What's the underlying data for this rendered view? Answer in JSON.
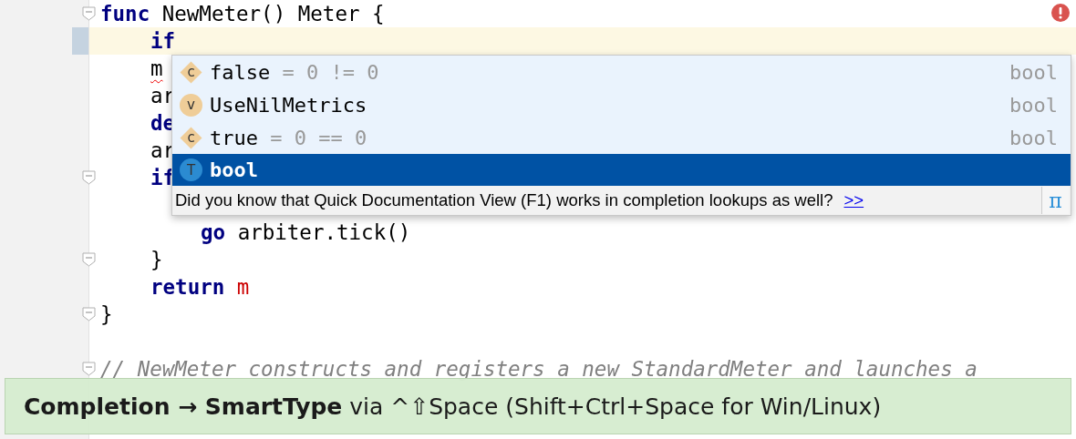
{
  "editor": {
    "lines": [
      {
        "tokens": [
          {
            "text": "func",
            "kind": "keyword"
          },
          {
            "text": " NewMeter() Meter {",
            "kind": "plain"
          }
        ],
        "fold": true,
        "current": false,
        "error": false,
        "children": [
          {
            "tokens": [
              {
                "text": "if",
                "kind": "keyword"
              }
            ],
            "fold": false,
            "current": true,
            "error": false
          },
          {
            "tokens": [
              {
                "text": "m",
                "kind": "plain"
              }
            ],
            "fold": false,
            "current": false,
            "error": true
          },
          {
            "tokens": [
              {
                "text": "ar",
                "kind": "plain"
              }
            ],
            "fold": false,
            "current": false,
            "error": false
          },
          {
            "tokens": [
              {
                "text": "de",
                "kind": "keyword"
              }
            ],
            "fold": false,
            "current": false,
            "error": false
          },
          {
            "tokens": [
              {
                "text": "ar",
                "kind": "plain"
              }
            ],
            "fold": false,
            "current": false,
            "error": false
          },
          {
            "tokens": [
              {
                "text": "if",
                "kind": "keyword"
              }
            ],
            "fold": true,
            "current": false,
            "error": false,
            "children": [
              {
                "fold": false,
                "current": false,
                "error": false
              },
              {
                "tokens": [
                  {
                    "text": "go",
                    "kind": "keyword"
                  },
                  {
                    "text": " arbiter.tick()",
                    "kind": "plain"
                  }
                ],
                "fold": false,
                "current": false,
                "error": false
              }
            ]
          },
          {
            "tokens": [
              {
                "text": "}",
                "kind": "plain"
              }
            ],
            "fold": true,
            "current": false,
            "error": false
          },
          {
            "tokens": [
              {
                "text": "return",
                "kind": "keyword"
              },
              {
                "text": " m",
                "kind": "variable"
              }
            ],
            "fold": false,
            "current": false,
            "error": false
          }
        ]
      },
      {
        "tokens": [
          {
            "text": "}",
            "kind": "plain"
          }
        ],
        "fold": true,
        "current": false,
        "error": false
      },
      {
        "fold": false,
        "current": false,
        "error": false
      },
      {
        "tokens": [
          {
            "text": "// NewMeter constructs and registers a new StandardMeter and launches a",
            "kind": "comment"
          }
        ],
        "fold": true,
        "current": false,
        "error": false
      }
    ]
  },
  "completion": {
    "items": [
      {
        "kind": "constant",
        "letter": "c",
        "name": "false",
        "detail": " = 0 != 0",
        "type": "bool",
        "selected": false
      },
      {
        "kind": "variable",
        "letter": "v",
        "name": "UseNilMetrics",
        "type": "bool",
        "selected": false
      },
      {
        "kind": "constant",
        "letter": "c",
        "name": "true",
        "detail": " = 0 == 0",
        "type": "bool",
        "selected": false
      },
      {
        "kind": "type",
        "letter": "T",
        "name": "bool",
        "selected": true
      }
    ],
    "tip": "Did you know that Quick Documentation View (F1) works in completion lookups as well?",
    "tip_link": ">>",
    "pi_button": "π"
  },
  "banner": "**Completion → SmartType** via ^⇧Space (Shift+Ctrl+Space for Win/Linux)"
}
